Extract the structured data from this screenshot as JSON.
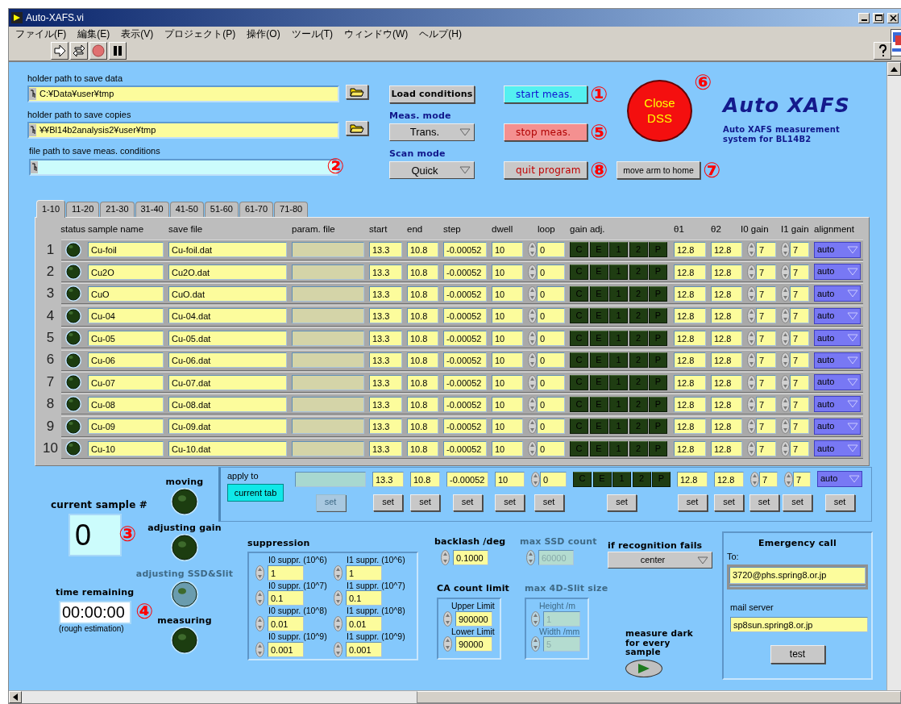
{
  "window": {
    "title": "Auto-XAFS.vi"
  },
  "menu": [
    "ファイル(F)",
    "編集(E)",
    "表示(V)",
    "プロジェクト(P)",
    "操作(O)",
    "ツール(T)",
    "ウィンドウ(W)",
    "ヘルプ(H)"
  ],
  "paths": [
    {
      "label": "holder path to save data",
      "value": "C:¥Data¥user¥tmp",
      "browse": true
    },
    {
      "label": "holder path to save copies",
      "value": "¥¥Bl14b2analysis2¥user¥tmp",
      "browse": true
    },
    {
      "label": "file path to save meas. conditions",
      "browse": false,
      "annotation": "②"
    }
  ],
  "load_button": "Load conditions",
  "modes": [
    {
      "label": "Meas. mode",
      "value": "Trans."
    },
    {
      "label": "Scan mode",
      "value": "Quick"
    }
  ],
  "actions": [
    {
      "kind": "start",
      "label": "start meas.",
      "annotation": "①"
    },
    {
      "kind": "stop",
      "label": "stop meas.",
      "annotation": "⑤"
    },
    {
      "kind": "quit",
      "label": "quit program",
      "annotation": "⑧"
    }
  ],
  "move_arm": {
    "label": "move arm to home",
    "annotation": "⑦"
  },
  "close_dss": {
    "label": "Close DSS",
    "annotation": "⑥"
  },
  "logo": {
    "title": "Auto XAFS",
    "subtitle": "Auto XAFS measurement system for BL14B2"
  },
  "tabs": [
    {
      "label": "1-10",
      "selected": true
    },
    {
      "label": "11-20",
      "selected": false
    },
    {
      "label": "21-30",
      "selected": false
    },
    {
      "label": "31-40",
      "selected": false
    },
    {
      "label": "41-50",
      "selected": false
    },
    {
      "label": "51-60",
      "selected": false
    },
    {
      "label": "61-70",
      "selected": false
    },
    {
      "label": "71-80",
      "selected": false
    }
  ],
  "table": {
    "columns": [
      "status",
      "sample name",
      "save file",
      "param. file",
      "start",
      "end",
      "step",
      "dwell",
      "loop",
      "gain adj.",
      "θ1",
      "θ2",
      "I0 gain",
      "I1 gain",
      "alignment"
    ],
    "rows": [
      {
        "index": "1",
        "led_on": false,
        "name": "Cu-foil",
        "file": "Cu-foil.dat",
        "start": "13.3",
        "end": "10.8",
        "step": "-0.00052",
        "dwell": "10",
        "loop": "0",
        "gain_adj": [
          "C",
          "E",
          "1",
          "2",
          "P"
        ],
        "theta1": "12.8",
        "theta2": "12.8",
        "i0_gain": "7",
        "i1_gain": "7",
        "alignment": "auto"
      },
      {
        "index": "2",
        "led_on": false,
        "name": "Cu2O",
        "file": "Cu2O.dat",
        "start": "13.3",
        "end": "10.8",
        "step": "-0.00052",
        "dwell": "10",
        "loop": "0",
        "gain_adj": [
          "C",
          "E",
          "1",
          "2",
          "P"
        ],
        "theta1": "12.8",
        "theta2": "12.8",
        "i0_gain": "7",
        "i1_gain": "7",
        "alignment": "auto"
      },
      {
        "index": "3",
        "led_on": false,
        "name": "CuO",
        "file": "CuO.dat",
        "start": "13.3",
        "end": "10.8",
        "step": "-0.00052",
        "dwell": "10",
        "loop": "0",
        "gain_adj": [
          "C",
          "E",
          "1",
          "2",
          "P"
        ],
        "theta1": "12.8",
        "theta2": "12.8",
        "i0_gain": "7",
        "i1_gain": "7",
        "alignment": "auto"
      },
      {
        "index": "4",
        "led_on": false,
        "name": "Cu-04",
        "file": "Cu-04.dat",
        "start": "13.3",
        "end": "10.8",
        "step": "-0.00052",
        "dwell": "10",
        "loop": "0",
        "gain_adj": [
          "C",
          "E",
          "1",
          "2",
          "P"
        ],
        "theta1": "12.8",
        "theta2": "12.8",
        "i0_gain": "7",
        "i1_gain": "7",
        "alignment": "auto"
      },
      {
        "index": "5",
        "led_on": false,
        "name": "Cu-05",
        "file": "Cu-05.dat",
        "start": "13.3",
        "end": "10.8",
        "step": "-0.00052",
        "dwell": "10",
        "loop": "0",
        "gain_adj": [
          "C",
          "E",
          "1",
          "2",
          "P"
        ],
        "theta1": "12.8",
        "theta2": "12.8",
        "i0_gain": "7",
        "i1_gain": "7",
        "alignment": "auto"
      },
      {
        "index": "6",
        "led_on": false,
        "name": "Cu-06",
        "file": "Cu-06.dat",
        "start": "13.3",
        "end": "10.8",
        "step": "-0.00052",
        "dwell": "10",
        "loop": "0",
        "gain_adj": [
          "C",
          "E",
          "1",
          "2",
          "P"
        ],
        "theta1": "12.8",
        "theta2": "12.8",
        "i0_gain": "7",
        "i1_gain": "7",
        "alignment": "auto"
      },
      {
        "index": "7",
        "led_on": false,
        "name": "Cu-07",
        "file": "Cu-07.dat",
        "start": "13.3",
        "end": "10.8",
        "step": "-0.00052",
        "dwell": "10",
        "loop": "0",
        "gain_adj": [
          "C",
          "E",
          "1",
          "2",
          "P"
        ],
        "theta1": "12.8",
        "theta2": "12.8",
        "i0_gain": "7",
        "i1_gain": "7",
        "alignment": "auto"
      },
      {
        "index": "8",
        "led_on": false,
        "name": "Cu-08",
        "file": "Cu-08.dat",
        "start": "13.3",
        "end": "10.8",
        "step": "-0.00052",
        "dwell": "10",
        "loop": "0",
        "gain_adj": [
          "C",
          "E",
          "1",
          "2",
          "P"
        ],
        "theta1": "12.8",
        "theta2": "12.8",
        "i0_gain": "7",
        "i1_gain": "7",
        "alignment": "auto"
      },
      {
        "index": "9",
        "led_on": false,
        "name": "Cu-09",
        "file": "Cu-09.dat",
        "start": "13.3",
        "end": "10.8",
        "step": "-0.00052",
        "dwell": "10",
        "loop": "0",
        "gain_adj": [
          "C",
          "E",
          "1",
          "2",
          "P"
        ],
        "theta1": "12.8",
        "theta2": "12.8",
        "i0_gain": "7",
        "i1_gain": "7",
        "alignment": "auto"
      },
      {
        "index": "10",
        "led_on": false,
        "name": "Cu-10",
        "file": "Cu-10.dat",
        "start": "13.3",
        "end": "10.8",
        "step": "-0.00052",
        "dwell": "10",
        "loop": "0",
        "gain_adj": [
          "C",
          "E",
          "1",
          "2",
          "P"
        ],
        "theta1": "12.8",
        "theta2": "12.8",
        "i0_gain": "7",
        "i1_gain": "7",
        "alignment": "auto"
      }
    ]
  },
  "apply": {
    "label": "apply to",
    "target": "current tab",
    "fields": [
      {
        "kind": "text",
        "set": {
          "label": "set",
          "disabled": true
        }
      },
      {
        "kind": "text",
        "value": "13.3",
        "set": {
          "label": "set",
          "disabled": false
        }
      },
      {
        "kind": "text",
        "value": "10.8",
        "set": {
          "label": "set",
          "disabled": false
        }
      },
      {
        "kind": "text",
        "value": "-0.00052",
        "set": {
          "label": "set",
          "disabled": false
        }
      },
      {
        "kind": "text",
        "value": "10",
        "set": {
          "label": "set",
          "disabled": false
        }
      },
      {
        "kind": "spin",
        "value": "0",
        "set": {
          "label": "set",
          "disabled": false
        }
      },
      {
        "kind": "gain",
        "buttons": [
          "C",
          "E",
          "1",
          "2",
          "P"
        ],
        "set": {
          "label": "set",
          "disabled": false
        }
      },
      {
        "kind": "text",
        "value": "12.8",
        "set": {
          "label": "set",
          "disabled": false
        }
      },
      {
        "kind": "text",
        "value": "12.8",
        "set": {
          "label": "set",
          "disabled": false
        }
      },
      {
        "kind": "spin",
        "value": "7",
        "set": {
          "label": "set",
          "disabled": false
        }
      },
      {
        "kind": "spin",
        "value": "7",
        "set": {
          "label": "set",
          "disabled": false
        }
      },
      {
        "kind": "dropdown",
        "value": "auto",
        "set": {
          "label": "set",
          "disabled": false
        }
      }
    ]
  },
  "current_sample": {
    "label": "current sample #",
    "value": "0",
    "annotation": "③"
  },
  "time_remaining": {
    "label": "time remaining",
    "value": "00:00:00",
    "note": "(rough estimation)",
    "annotation": "④"
  },
  "indicators": [
    {
      "label": "moving",
      "on": false,
      "disabled": false
    },
    {
      "label": "adjusting gain",
      "on": false,
      "disabled": false
    },
    {
      "label": "adjusting SSD&Slit",
      "on": false,
      "disabled": true
    },
    {
      "label": "measuring",
      "on": false,
      "disabled": false
    }
  ],
  "suppression": {
    "label": "suppression",
    "items": [
      {
        "label": "I0 suppr. (10^6)",
        "value": "1"
      },
      {
        "label": "I1 suppr. (10^6)",
        "value": "1"
      },
      {
        "label": "I0 suppr. (10^7)",
        "value": "0.1"
      },
      {
        "label": "I1 suppr. (10^7)",
        "value": "0.1"
      },
      {
        "label": "I0 suppr. (10^8)",
        "value": "0.01"
      },
      {
        "label": "I1 suppr. (10^8)",
        "value": "0.01"
      },
      {
        "label": "I0 suppr. (10^9)",
        "value": "0.001"
      },
      {
        "label": "I1 suppr. (10^9)",
        "value": "0.001"
      }
    ]
  },
  "backlash": {
    "label": "backlash /deg",
    "value": "0.1000",
    "disabled": false
  },
  "max_ssd": {
    "label": "max SSD count",
    "value": "60000",
    "disabled": true
  },
  "recognition": {
    "label": "if recognition fails",
    "value": "center"
  },
  "ca_limit": {
    "label": "CA count limit",
    "disabled": false,
    "items": [
      {
        "label": "Upper Limit",
        "value": "900000"
      },
      {
        "label": "Lower Limit",
        "value": "90000"
      }
    ]
  },
  "slit_size": {
    "label": "max 4D-Slit size",
    "disabled": true,
    "items": [
      {
        "label": "Height /m",
        "value": "1"
      },
      {
        "label": "Width /mm",
        "value": "5"
      }
    ]
  },
  "measure_dark": {
    "label": "measure dark for every sample",
    "on": false
  },
  "emergency": {
    "title": "Emergency call",
    "to_label": "To:",
    "to": "3720@phs.spring8.or.jp",
    "server_label": "mail server",
    "server": "sp8sun.spring8.or.jp",
    "test": "test"
  }
}
